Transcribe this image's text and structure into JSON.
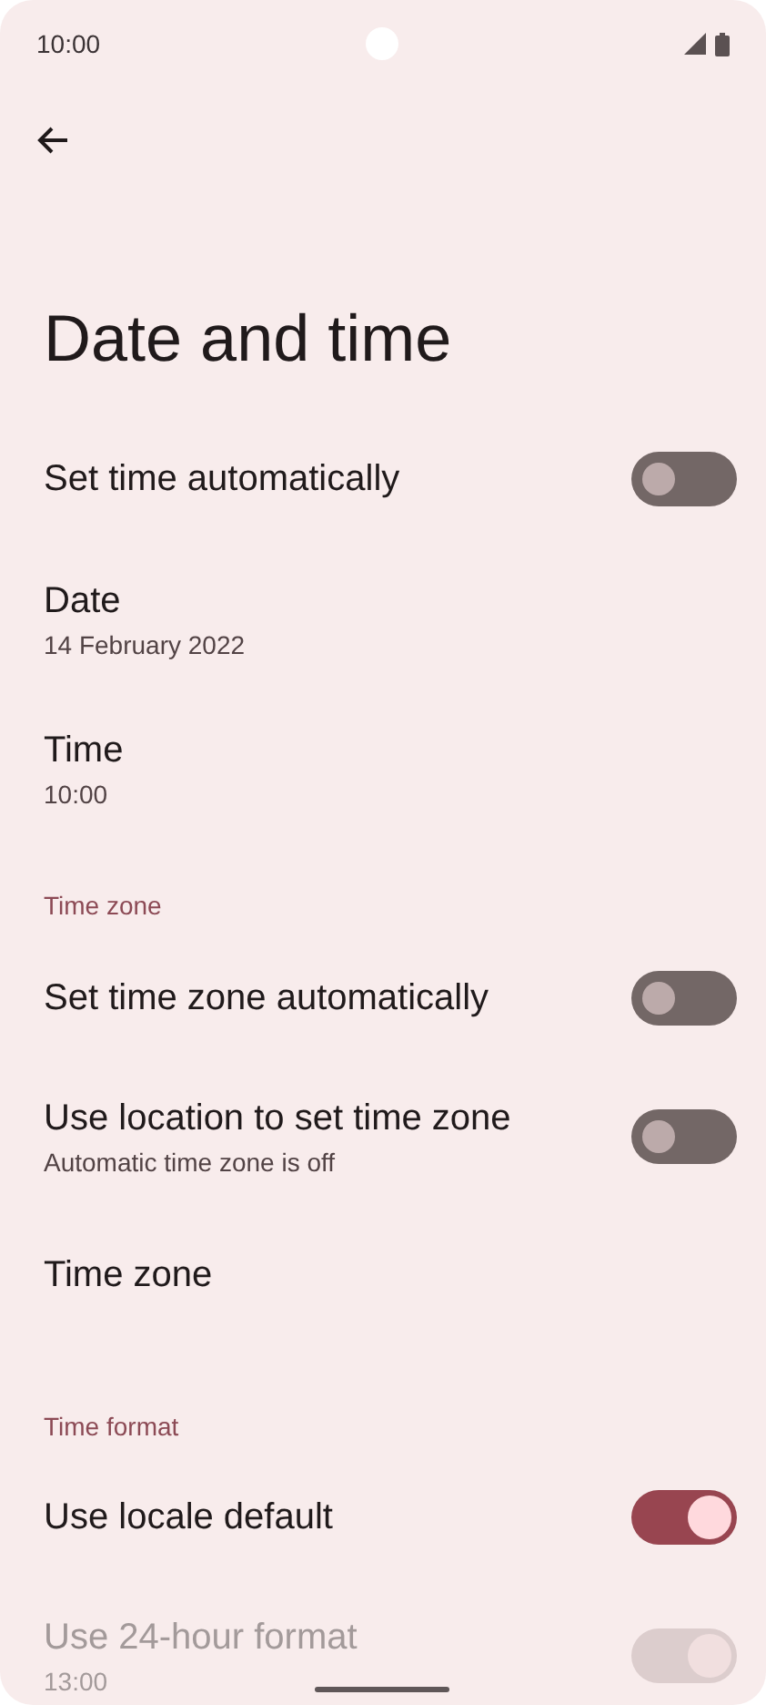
{
  "status_bar": {
    "time": "10:00"
  },
  "title": "Date and time",
  "items": [
    {
      "kind": "toggle",
      "title": "Set time automatically",
      "on": false,
      "disabled": false
    },
    {
      "kind": "plain",
      "title": "Date",
      "subtitle": "14 February 2022"
    },
    {
      "kind": "plain",
      "title": "Time",
      "subtitle": "10:00"
    },
    {
      "kind": "header",
      "title": "Time zone"
    },
    {
      "kind": "toggle",
      "title": "Set time zone automatically",
      "on": false,
      "disabled": false
    },
    {
      "kind": "toggle",
      "title": "Use location to set time zone",
      "subtitle": "Automatic time zone is off",
      "on": false,
      "disabled": false
    },
    {
      "kind": "plain",
      "title": "Time zone"
    },
    {
      "kind": "header",
      "title": "Time format"
    },
    {
      "kind": "toggle",
      "title": "Use locale default",
      "on": true,
      "disabled": false
    },
    {
      "kind": "toggle",
      "title": "Use 24-hour format",
      "subtitle": "13:00",
      "on": true,
      "disabled": true
    }
  ]
}
